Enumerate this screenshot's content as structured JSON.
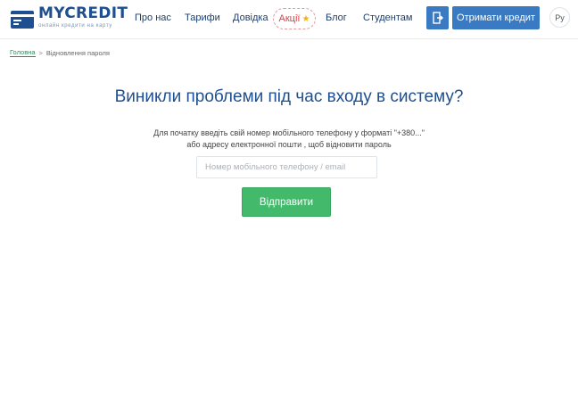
{
  "brand": {
    "name": "MYCREDIT",
    "tagline": "онлайн кредити на карту",
    "color": "#1d4f91"
  },
  "nav": {
    "items": [
      {
        "label": "Про нас"
      },
      {
        "label": "Тарифи"
      },
      {
        "label": "Довідка"
      },
      {
        "label": "Акції",
        "icon": "star-icon"
      },
      {
        "label": "Блог"
      },
      {
        "label": "Студентам"
      }
    ],
    "login_icon": "login-icon",
    "cta_label": "Отримати кредит",
    "language": "Ру"
  },
  "breadcrumb": {
    "home": "Головна",
    "separator": ">",
    "current": "Відновлення пароля"
  },
  "main": {
    "title": "Виникли проблеми під час входу в систему?",
    "description_line1": "Для початку введіть свій номер мобільного телефону у форматі \"+380...\"",
    "description_line2": "або адресу електронної пошти , щоб відновити пароль",
    "input": {
      "placeholder": "Номер мобільного телефону / email",
      "value": ""
    },
    "submit_label": "Відправити"
  },
  "colors": {
    "accent": "#3a7ac2",
    "title": "#1d4f91",
    "success": "#43b96b",
    "promo": "#d93f46"
  }
}
